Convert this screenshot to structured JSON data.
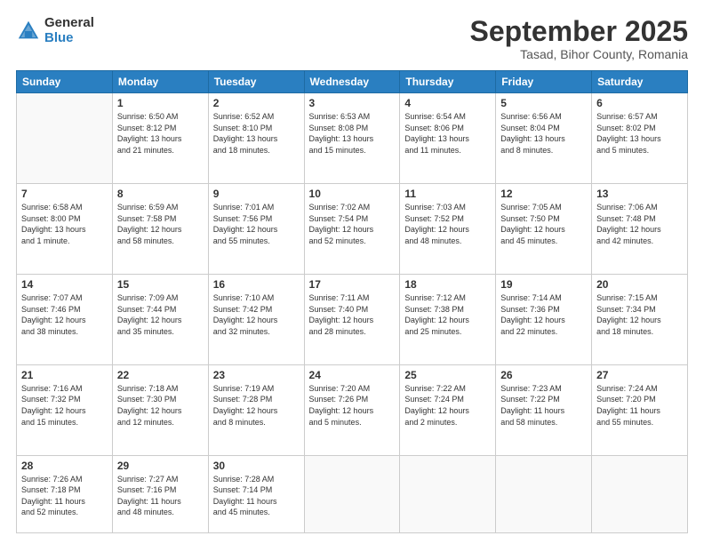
{
  "logo": {
    "general": "General",
    "blue": "Blue"
  },
  "title": {
    "month": "September 2025",
    "location": "Tasad, Bihor County, Romania"
  },
  "weekdays": [
    "Sunday",
    "Monday",
    "Tuesday",
    "Wednesday",
    "Thursday",
    "Friday",
    "Saturday"
  ],
  "weeks": [
    [
      {
        "day": "",
        "info": ""
      },
      {
        "day": "1",
        "info": "Sunrise: 6:50 AM\nSunset: 8:12 PM\nDaylight: 13 hours\nand 21 minutes."
      },
      {
        "day": "2",
        "info": "Sunrise: 6:52 AM\nSunset: 8:10 PM\nDaylight: 13 hours\nand 18 minutes."
      },
      {
        "day": "3",
        "info": "Sunrise: 6:53 AM\nSunset: 8:08 PM\nDaylight: 13 hours\nand 15 minutes."
      },
      {
        "day": "4",
        "info": "Sunrise: 6:54 AM\nSunset: 8:06 PM\nDaylight: 13 hours\nand 11 minutes."
      },
      {
        "day": "5",
        "info": "Sunrise: 6:56 AM\nSunset: 8:04 PM\nDaylight: 13 hours\nand 8 minutes."
      },
      {
        "day": "6",
        "info": "Sunrise: 6:57 AM\nSunset: 8:02 PM\nDaylight: 13 hours\nand 5 minutes."
      }
    ],
    [
      {
        "day": "7",
        "info": "Sunrise: 6:58 AM\nSunset: 8:00 PM\nDaylight: 13 hours\nand 1 minute."
      },
      {
        "day": "8",
        "info": "Sunrise: 6:59 AM\nSunset: 7:58 PM\nDaylight: 12 hours\nand 58 minutes."
      },
      {
        "day": "9",
        "info": "Sunrise: 7:01 AM\nSunset: 7:56 PM\nDaylight: 12 hours\nand 55 minutes."
      },
      {
        "day": "10",
        "info": "Sunrise: 7:02 AM\nSunset: 7:54 PM\nDaylight: 12 hours\nand 52 minutes."
      },
      {
        "day": "11",
        "info": "Sunrise: 7:03 AM\nSunset: 7:52 PM\nDaylight: 12 hours\nand 48 minutes."
      },
      {
        "day": "12",
        "info": "Sunrise: 7:05 AM\nSunset: 7:50 PM\nDaylight: 12 hours\nand 45 minutes."
      },
      {
        "day": "13",
        "info": "Sunrise: 7:06 AM\nSunset: 7:48 PM\nDaylight: 12 hours\nand 42 minutes."
      }
    ],
    [
      {
        "day": "14",
        "info": "Sunrise: 7:07 AM\nSunset: 7:46 PM\nDaylight: 12 hours\nand 38 minutes."
      },
      {
        "day": "15",
        "info": "Sunrise: 7:09 AM\nSunset: 7:44 PM\nDaylight: 12 hours\nand 35 minutes."
      },
      {
        "day": "16",
        "info": "Sunrise: 7:10 AM\nSunset: 7:42 PM\nDaylight: 12 hours\nand 32 minutes."
      },
      {
        "day": "17",
        "info": "Sunrise: 7:11 AM\nSunset: 7:40 PM\nDaylight: 12 hours\nand 28 minutes."
      },
      {
        "day": "18",
        "info": "Sunrise: 7:12 AM\nSunset: 7:38 PM\nDaylight: 12 hours\nand 25 minutes."
      },
      {
        "day": "19",
        "info": "Sunrise: 7:14 AM\nSunset: 7:36 PM\nDaylight: 12 hours\nand 22 minutes."
      },
      {
        "day": "20",
        "info": "Sunrise: 7:15 AM\nSunset: 7:34 PM\nDaylight: 12 hours\nand 18 minutes."
      }
    ],
    [
      {
        "day": "21",
        "info": "Sunrise: 7:16 AM\nSunset: 7:32 PM\nDaylight: 12 hours\nand 15 minutes."
      },
      {
        "day": "22",
        "info": "Sunrise: 7:18 AM\nSunset: 7:30 PM\nDaylight: 12 hours\nand 12 minutes."
      },
      {
        "day": "23",
        "info": "Sunrise: 7:19 AM\nSunset: 7:28 PM\nDaylight: 12 hours\nand 8 minutes."
      },
      {
        "day": "24",
        "info": "Sunrise: 7:20 AM\nSunset: 7:26 PM\nDaylight: 12 hours\nand 5 minutes."
      },
      {
        "day": "25",
        "info": "Sunrise: 7:22 AM\nSunset: 7:24 PM\nDaylight: 12 hours\nand 2 minutes."
      },
      {
        "day": "26",
        "info": "Sunrise: 7:23 AM\nSunset: 7:22 PM\nDaylight: 11 hours\nand 58 minutes."
      },
      {
        "day": "27",
        "info": "Sunrise: 7:24 AM\nSunset: 7:20 PM\nDaylight: 11 hours\nand 55 minutes."
      }
    ],
    [
      {
        "day": "28",
        "info": "Sunrise: 7:26 AM\nSunset: 7:18 PM\nDaylight: 11 hours\nand 52 minutes."
      },
      {
        "day": "29",
        "info": "Sunrise: 7:27 AM\nSunset: 7:16 PM\nDaylight: 11 hours\nand 48 minutes."
      },
      {
        "day": "30",
        "info": "Sunrise: 7:28 AM\nSunset: 7:14 PM\nDaylight: 11 hours\nand 45 minutes."
      },
      {
        "day": "",
        "info": ""
      },
      {
        "day": "",
        "info": ""
      },
      {
        "day": "",
        "info": ""
      },
      {
        "day": "",
        "info": ""
      }
    ]
  ]
}
